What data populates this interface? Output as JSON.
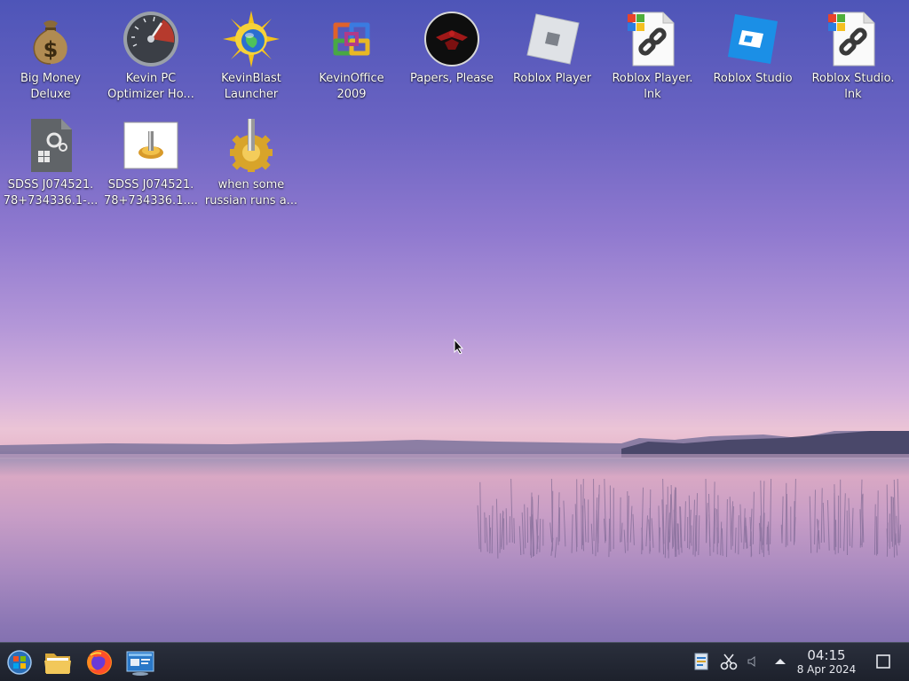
{
  "desktop": {
    "icons": [
      {
        "label": "Big Money\nDeluxe",
        "icon": "money-bag-icon"
      },
      {
        "label": "Kevin PC\nOptimizer Ho...",
        "icon": "speedometer-icon"
      },
      {
        "label": "KevinBlast\nLauncher",
        "icon": "sun-globe-icon"
      },
      {
        "label": "KevinOffice\n2009",
        "icon": "office-knot-icon"
      },
      {
        "label": "Papers, Please",
        "icon": "eagle-emblem-icon"
      },
      {
        "label": "Roblox Player",
        "icon": "roblox-icon"
      },
      {
        "label": "Roblox Player.\nlnk",
        "icon": "shortcut-link-icon"
      },
      {
        "label": "Roblox Studio",
        "icon": "roblox-studio-icon"
      },
      {
        "label": "Roblox Studio.\nlnk",
        "icon": "shortcut-link-icon"
      },
      {
        "label": "SDSS J074521.\n78+734336.1-...",
        "icon": "executable-gear-icon"
      },
      {
        "label": "SDSS J074521.\n78+734336.1....",
        "icon": "installer-icon"
      },
      {
        "label": "when some\nrussian runs a...",
        "icon": "gear-installer-icon"
      }
    ]
  },
  "taskbar": {
    "launchers": [
      {
        "name": "start-menu-button",
        "icon": "windows-orb-icon"
      },
      {
        "name": "file-manager-button",
        "icon": "folder-icon"
      },
      {
        "name": "firefox-button",
        "icon": "firefox-icon"
      },
      {
        "name": "control-panel-button",
        "icon": "control-panel-icon"
      }
    ],
    "tray": {
      "time": "04:15",
      "date": "8 Apr 2024"
    }
  },
  "colors": {
    "taskbar_bg": "#1d212c",
    "label_text": "#ffffff"
  }
}
